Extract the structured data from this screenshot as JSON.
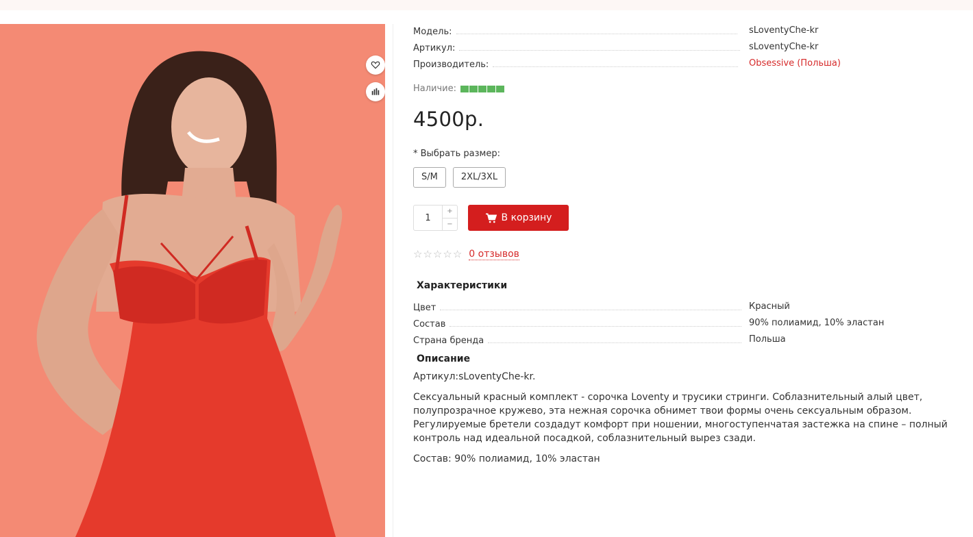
{
  "product": {
    "attributes": [
      {
        "label": "Модель:",
        "value": "sLoventyChe-kr"
      },
      {
        "label": "Артикул:",
        "value": "sLoventyChe-kr"
      },
      {
        "label": "Производитель:",
        "value": "Obsessive (Польша)"
      }
    ],
    "stock_label": "Наличие:",
    "stock_level": 1.0,
    "price": "4500р.",
    "size_label": "* Выбрать размер:",
    "sizes": [
      "S/M",
      "2XL/3XL"
    ],
    "quantity": "1",
    "qty_plus": "+",
    "qty_minus": "−",
    "cart_button": "В корзину",
    "rating_stars": 0,
    "reviews_link": "0 отзывов",
    "specs_title": "Характеристики",
    "specs": [
      {
        "label": "Цвет",
        "value": "Красный"
      },
      {
        "label": "Состав",
        "value": "90% полиамид, 10% эластан"
      },
      {
        "label": "Страна бренда",
        "value": "Польша"
      }
    ],
    "description_title": "Описание",
    "description": [
      "Артикул:sLoventyChe-kr.",
      "Сексуальный красный комплект - сорочка Loventy и трусики стринги. Соблазнительный алый цвет, полупрозрачное кружево, эта нежная сорочка обнимет твои формы очень сексуальным образом. Регулируемые бретели создадут комфорт при ношении, многоступенчатая застежка на спине – полный контроль над идеальной посадкой, соблазнительный вырез сзади.",
      "Состав: 90% полиамид, 10% эластан"
    ]
  },
  "icons": {
    "wishlist": "heart-icon",
    "compare": "bar-chart-icon",
    "cart": "cart-icon",
    "star": "star-icon"
  },
  "colors": {
    "accent_red": "#d41e1e",
    "photo_bg": "#f48a74",
    "stock_green": "#5cb65c"
  }
}
